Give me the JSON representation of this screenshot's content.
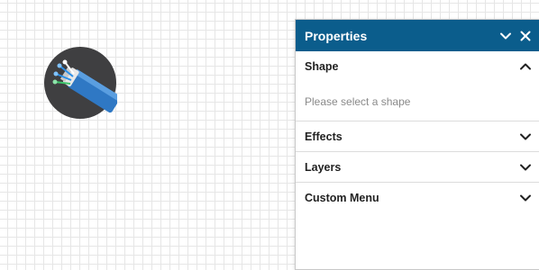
{
  "canvas": {
    "shape_icon": "fiber-optic-cable-icon"
  },
  "panel": {
    "title": "Properties",
    "header_color": "#0b5d8c",
    "minimize_icon": "chevron-down-icon",
    "close_icon": "close-icon",
    "sections": [
      {
        "label": "Shape",
        "expanded": true,
        "content": "Please select a shape"
      },
      {
        "label": "Effects",
        "expanded": false
      },
      {
        "label": "Layers",
        "expanded": false
      },
      {
        "label": "Custom Menu",
        "expanded": false
      }
    ]
  }
}
